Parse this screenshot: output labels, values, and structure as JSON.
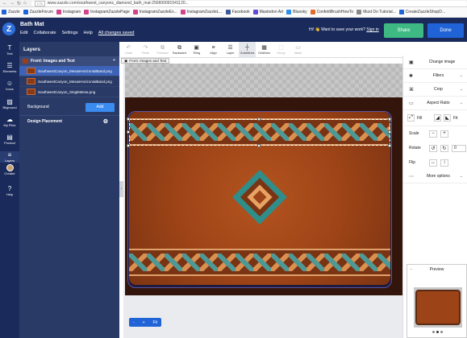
{
  "browser": {
    "nav": [
      "←",
      "→",
      "↻",
      "⌂"
    ],
    "badge": "Y75",
    "url": "www.zazzle.com/southwest_canyons_diamond_bath_mat-256600091541120..."
  },
  "bookmarks": [
    {
      "label": "Zazzle",
      "color": "#1f63d6"
    },
    {
      "label": "ZazzleForum",
      "color": "#1f63d6"
    },
    {
      "label": "Instagram",
      "color": "#d1448b"
    },
    {
      "label": "InstagramZazzlePage",
      "color": "#d1448b"
    },
    {
      "label": "InstagramZazzleEx...",
      "color": "#d1448b"
    },
    {
      "label": "InstagramZazzleL...",
      "color": "#d1448b"
    },
    {
      "label": "Facebook",
      "color": "#3b5998"
    },
    {
      "label": "Mastodon Art",
      "color": "#5f4ad6"
    },
    {
      "label": "Bluesky",
      "color": "#2c8dea"
    },
    {
      "label": "ConfettiBrushHowTo",
      "color": "#e06b2b"
    },
    {
      "label": "Must Do Tutorial...",
      "color": "#888888"
    },
    {
      "label": "CreateZazzleShopD...",
      "color": "#1f63d6"
    }
  ],
  "header": {
    "logo": "Z",
    "title": "Bath Mat",
    "menus": [
      "Edit",
      "Collaborate",
      "Settings",
      "Help"
    ],
    "saved": "All changes saved",
    "save_hint_prefix": "Hi! 👋 Want to save your work?",
    "save_hint_link": "Sign in",
    "share_label": "Share",
    "done_label": "Done"
  },
  "rail": [
    {
      "icon": "T",
      "label": "Text",
      "name": "text"
    },
    {
      "icon": "☰",
      "label": "Elements",
      "name": "elements"
    },
    {
      "icon": "☺",
      "label": "Icons",
      "name": "icons"
    },
    {
      "icon": "▨",
      "label": "Bkground",
      "name": "bkground"
    },
    {
      "icon": "☁",
      "label": "My Files",
      "name": "my-files"
    },
    {
      "icon": "▤",
      "label": "Product",
      "name": "product"
    },
    {
      "icon": "≡",
      "label": "Layers",
      "name": "layers"
    },
    {
      "icon": "",
      "label": "Creator",
      "name": "creator"
    },
    {
      "icon": "?",
      "label": "Help",
      "name": "help"
    }
  ],
  "layers_panel": {
    "title": "Layers",
    "group": "Front: Images and Text",
    "items": [
      "SouthwestCanyon_MesasHorizontalBand.png",
      "SouthwestCanyon_MesasHorizontalBand.png",
      "SouthwestCanyon_SingleMesa.png"
    ],
    "background_label": "Background",
    "add_label": "Add",
    "design_placement": "Design Placement"
  },
  "toolbar": [
    {
      "icon": "↶",
      "label": "Undo",
      "state": "disabled"
    },
    {
      "icon": "↷",
      "label": "Redo",
      "state": "disabled"
    },
    {
      "icon": "⧉",
      "label": "Forward",
      "state": "disabled"
    },
    {
      "icon": "⧉",
      "label": "Backward",
      "state": "normal"
    },
    {
      "icon": "▣",
      "label": "Tiling",
      "state": "normal"
    },
    {
      "icon": "≡",
      "label": "Align",
      "state": "normal"
    },
    {
      "icon": "☰",
      "label": "Layer",
      "state": "normal"
    },
    {
      "icon": "┼",
      "label": "Guidelines",
      "state": "active"
    },
    {
      "icon": "▦",
      "label": "Gridlines",
      "state": "normal"
    },
    {
      "icon": "⬚",
      "label": "Group",
      "state": "disabled"
    },
    {
      "icon": "▭",
      "label": "Mask",
      "state": "disabled"
    }
  ],
  "canvas_tab": "Front: Images and Text",
  "zoom": {
    "minus": "-",
    "plus": "+",
    "fit": "Fit"
  },
  "right_panel": {
    "change_image": "Change image",
    "filters": "Filters",
    "crop": "Crop",
    "aspect_ratio": "Aspect Ratio",
    "fill": "Fill",
    "fit": "Fit",
    "scale": "Scale",
    "rotate": "Rotate",
    "rotate_value": "0",
    "flip": "Flip",
    "more_options": "More options"
  },
  "preview": {
    "title": "Preview",
    "minimize": "-",
    "dots": 3,
    "active_dot": 1
  },
  "colors": {
    "header": "#1a2b5b",
    "panel": "#293a66",
    "accent": "#1f63d6",
    "share": "#3fb984",
    "selected_layer": "#3c63b8"
  }
}
